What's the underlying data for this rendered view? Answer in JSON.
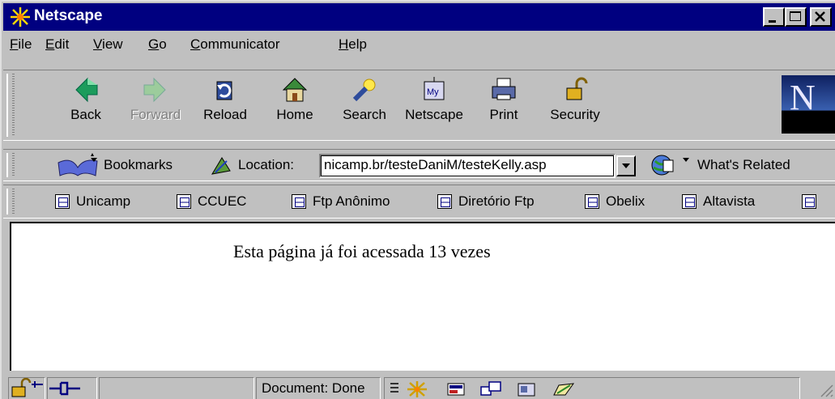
{
  "window": {
    "title": "Netscape"
  },
  "menu": [
    "File",
    "Edit",
    "View",
    "Go",
    "Communicator",
    "Help"
  ],
  "menu_accel": [
    "F",
    "E",
    "V",
    "G",
    "C",
    "H"
  ],
  "navigation_toolbar": {
    "buttons": [
      {
        "label": "Back",
        "icon": "back-arrow-icon",
        "enabled": true
      },
      {
        "label": "Forward",
        "icon": "forward-arrow-icon",
        "enabled": false
      },
      {
        "label": "Reload",
        "icon": "reload-icon",
        "enabled": true
      },
      {
        "label": "Home",
        "icon": "home-icon",
        "enabled": true
      },
      {
        "label": "Search",
        "icon": "search-icon",
        "enabled": true
      },
      {
        "label": "Netscape",
        "icon": "my-netscape-icon",
        "enabled": true
      },
      {
        "label": "Print",
        "icon": "print-icon",
        "enabled": true
      },
      {
        "label": "Security",
        "icon": "security-lock-icon",
        "enabled": true
      }
    ],
    "logo_letter": "N"
  },
  "location_toolbar": {
    "bookmarks_label": "Bookmarks",
    "location_label": "Location:",
    "url": "nicamp.br/testeDaniM/testeKelly.asp",
    "whats_related_label": "What's Related"
  },
  "personal_toolbar": {
    "links": [
      "Unicamp",
      "CCUEC",
      "Ftp Anônimo",
      "Diretório Ftp",
      "Obelix",
      "Altavista"
    ]
  },
  "page": {
    "text": "Esta página já foi acessada 13 vezes"
  },
  "status": {
    "text": "Document: Done"
  },
  "colors": {
    "titlebar": "#000080",
    "chrome": "#c0c0c0",
    "content_bg": "#ffffff"
  }
}
